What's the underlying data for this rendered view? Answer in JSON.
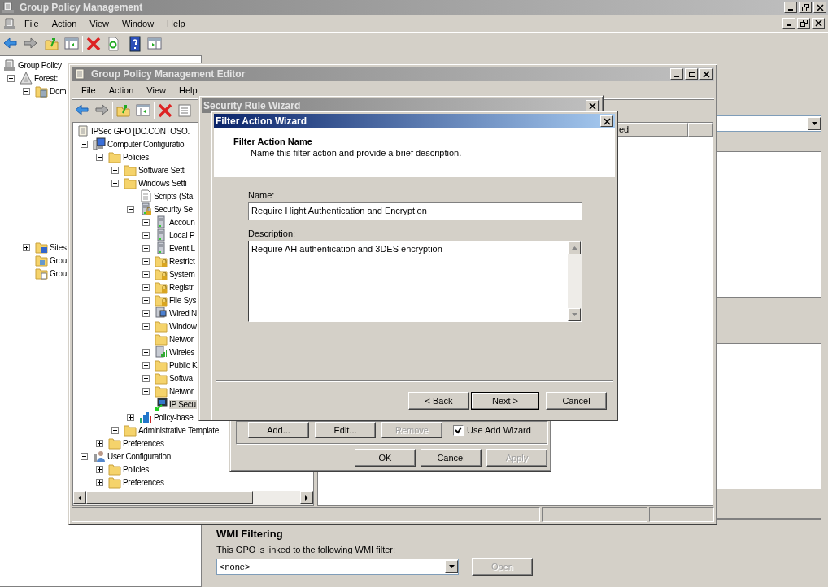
{
  "main_window": {
    "title": "Group Policy Management",
    "menu": [
      "File",
      "Action",
      "View",
      "Window",
      "Help"
    ],
    "tree": [
      {
        "label": "Group Policy",
        "kind": "console",
        "selected": false,
        "children": [
          {
            "label": "Forest:",
            "kind": "forest",
            "expanded": true,
            "selected": false,
            "children": [
              {
                "label": "Dom",
                "kind": "domain",
                "expanded": true,
                "selected": false
              },
              {
                "label": "Sites",
                "kind": "sites",
                "expanded": false,
                "selected": false
              },
              {
                "label": "Grou",
                "kind": "modeling",
                "selected": false
              },
              {
                "label": "Grou",
                "kind": "results",
                "selected": false
              }
            ]
          }
        ]
      }
    ],
    "wmi_filtering": {
      "heading": "WMI Filtering",
      "text": "This GPO is linked to the following WMI filter:",
      "filter": "<none>",
      "open_button": {
        "label": "Open",
        "disabled": true
      }
    }
  },
  "editor_window": {
    "title": "Group Policy Management Editor",
    "menu": [
      "File",
      "Action",
      "View",
      "Help"
    ],
    "column_header": "ed",
    "tree": [
      {
        "label": "IPSec GPO [DC.CONTOSO.",
        "kind": "gpo",
        "selected": false,
        "children": [
          {
            "label": "Computer Configuratio",
            "kind": "computer",
            "expanded": true,
            "selected": false,
            "children": [
              {
                "label": "Policies",
                "kind": "folder",
                "expanded": true,
                "selected": false,
                "children": [
                  {
                    "label": "Software Setti",
                    "kind": "folder",
                    "expanded": false,
                    "selected": false
                  },
                  {
                    "label": "Windows Setti",
                    "kind": "folder",
                    "expanded": true,
                    "selected": false,
                    "children": [
                      {
                        "label": "Scripts (Sta",
                        "kind": "script",
                        "selected": false
                      },
                      {
                        "label": "Security Se",
                        "kind": "security",
                        "expanded": true,
                        "selected": false,
                        "children": [
                          {
                            "label": "Accoun",
                            "kind": "server",
                            "expanded": false,
                            "selected": false
                          },
                          {
                            "label": "Local P",
                            "kind": "server",
                            "expanded": false,
                            "selected": false
                          },
                          {
                            "label": "Event L",
                            "kind": "server",
                            "expanded": false,
                            "selected": false
                          },
                          {
                            "label": "Restrict",
                            "kind": "secure-folder",
                            "expanded": false,
                            "selected": false
                          },
                          {
                            "label": "System",
                            "kind": "secure-folder",
                            "expanded": false,
                            "selected": false
                          },
                          {
                            "label": "Registr",
                            "kind": "secure-folder",
                            "expanded": false,
                            "selected": false
                          },
                          {
                            "label": "File Sys",
                            "kind": "secure-folder",
                            "expanded": false,
                            "selected": false
                          },
                          {
                            "label": "Wired N",
                            "kind": "network",
                            "expanded": false,
                            "selected": false
                          },
                          {
                            "label": "Window",
                            "kind": "folder",
                            "expanded": false,
                            "selected": false
                          },
                          {
                            "label": "Networ",
                            "kind": "folder",
                            "selected": false
                          },
                          {
                            "label": "Wireles",
                            "kind": "wireless",
                            "expanded": false,
                            "selected": false
                          },
                          {
                            "label": "Public K",
                            "kind": "folder",
                            "expanded": false,
                            "selected": false
                          },
                          {
                            "label": "Softwa",
                            "kind": "folder",
                            "expanded": false,
                            "selected": false
                          },
                          {
                            "label": "Networ",
                            "kind": "folder",
                            "expanded": false,
                            "selected": false
                          },
                          {
                            "label": "IP Secu",
                            "kind": "ipsec",
                            "selected": true
                          }
                        ]
                      },
                      {
                        "label": "Policy-base",
                        "kind": "qos",
                        "expanded": false,
                        "selected": false
                      }
                    ]
                  },
                  {
                    "label": "Administrative Template",
                    "kind": "folder",
                    "expanded": false,
                    "selected": false
                  }
                ]
              },
              {
                "label": "Preferences",
                "kind": "folder",
                "expanded": false,
                "selected": false
              }
            ]
          },
          {
            "label": "User Configuration",
            "kind": "user",
            "expanded": true,
            "selected": false,
            "children": [
              {
                "label": "Policies",
                "kind": "folder",
                "expanded": false,
                "selected": false
              },
              {
                "label": "Preferences",
                "kind": "folder",
                "expanded": false,
                "selected": false
              }
            ]
          }
        ]
      }
    ]
  },
  "security_rule_wizard": {
    "title": "Security Rule Wizard"
  },
  "properties_dialog": {
    "buttons": [
      {
        "label": "Add...",
        "disabled": false
      },
      {
        "label": "Edit...",
        "disabled": false
      },
      {
        "label": "Remove",
        "disabled": true
      }
    ],
    "use_add_wizard": {
      "label": "Use Add Wizard",
      "checked": true
    },
    "dialog_buttons": [
      {
        "label": "OK",
        "disabled": false
      },
      {
        "label": "Cancel",
        "disabled": false
      },
      {
        "label": "Apply",
        "disabled": true
      }
    ]
  },
  "filter_action_wizard": {
    "title": "Filter Action Wizard",
    "heading": "Filter Action Name",
    "subheading": "Name this filter action and provide a brief description.",
    "name_label": "Name:",
    "name_value": "Require Hight Authentication and Encryption",
    "description_label": "Description:",
    "description_value": "Require AH authentication and 3DES encryption",
    "buttons": [
      {
        "label": "< Back",
        "default": false
      },
      {
        "label": "Next >",
        "default": true
      },
      {
        "label": "Cancel",
        "default": false
      }
    ]
  }
}
